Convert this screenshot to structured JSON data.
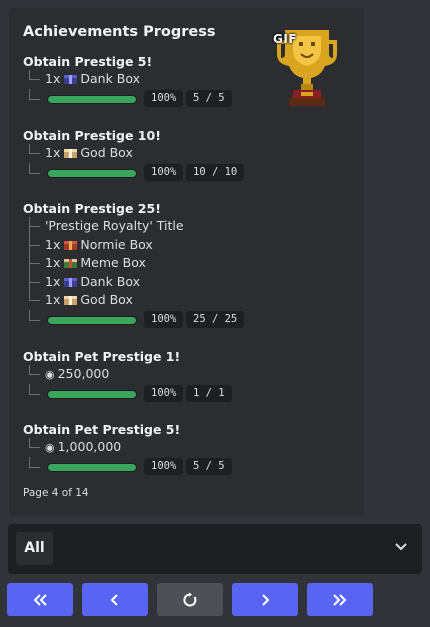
{
  "embed": {
    "title": "Achievements Progress",
    "thumbnail_badge": "GIF",
    "thumbnail_icon": "golden-trophy-icon",
    "footer": "Page 4 of 14"
  },
  "achievements": [
    {
      "title": "Obtain Prestige 5!",
      "rewards": [
        {
          "qty": "1x",
          "icon": "dank-box-icon",
          "name": "Dank Box"
        }
      ],
      "percent_label": "100%",
      "count_label": "5 / 5",
      "progress": 1.0
    },
    {
      "title": "Obtain Prestige 10!",
      "rewards": [
        {
          "qty": "1x",
          "icon": "god-box-icon",
          "name": "God Box"
        }
      ],
      "percent_label": "100%",
      "count_label": "10 / 10",
      "progress": 1.0
    },
    {
      "title": "Obtain Prestige 25!",
      "rewards": [
        {
          "qty": "",
          "icon": "",
          "name": "'Prestige Royalty' Title"
        },
        {
          "qty": "1x",
          "icon": "normie-box-icon",
          "name": "Normie Box"
        },
        {
          "qty": "1x",
          "icon": "meme-box-icon",
          "name": "Meme Box"
        },
        {
          "qty": "1x",
          "icon": "dank-box-icon",
          "name": "Dank Box"
        },
        {
          "qty": "1x",
          "icon": "god-box-icon",
          "name": "God Box"
        }
      ],
      "percent_label": "100%",
      "count_label": "25 / 25",
      "progress": 1.0
    },
    {
      "title": "Obtain Pet Prestige 1!",
      "rewards": [
        {
          "qty": "",
          "icon": "coin-icon",
          "name": "250,000"
        }
      ],
      "percent_label": "100%",
      "count_label": "1 / 1",
      "progress": 1.0
    },
    {
      "title": "Obtain Pet Prestige 5!",
      "rewards": [
        {
          "qty": "",
          "icon": "coin-icon",
          "name": "1,000,000"
        }
      ],
      "percent_label": "100%",
      "count_label": "5 / 5",
      "progress": 1.0
    }
  ],
  "select": {
    "selected": "All",
    "icon": "chevron-down-icon"
  },
  "pagination": [
    {
      "name": "first-page-button",
      "icon": "double-chevron-left-icon",
      "style": "primary"
    },
    {
      "name": "previous-page-button",
      "icon": "chevron-left-icon",
      "style": "primary"
    },
    {
      "name": "refresh-button",
      "icon": "refresh-icon",
      "style": "secondary"
    },
    {
      "name": "next-page-button",
      "icon": "chevron-right-icon",
      "style": "primary"
    },
    {
      "name": "last-page-button",
      "icon": "double-chevron-right-icon",
      "style": "primary"
    }
  ],
  "colors": {
    "background": "#313338",
    "embed": "#2b2d31",
    "progress_fill": "#3ba55c",
    "primary_button": "#5865f2",
    "secondary_button": "#4e5058"
  }
}
